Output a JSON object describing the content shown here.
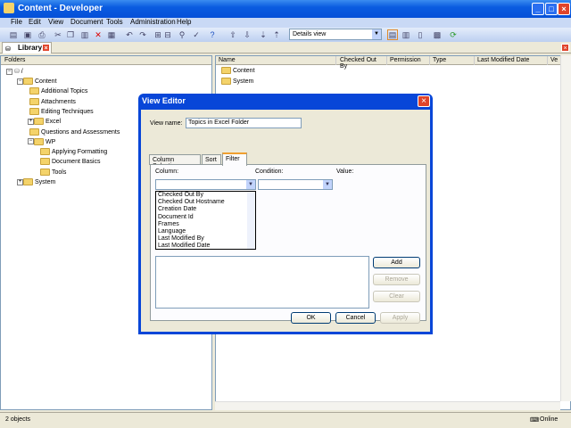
{
  "window": {
    "title": "Content - Developer"
  },
  "menu": [
    "File",
    "Edit",
    "View",
    "Document",
    "Tools",
    "Administration",
    "Help"
  ],
  "toolbar": {
    "view_select": "Details view"
  },
  "library_tab": "Library",
  "folders": {
    "header": "Folders",
    "root": "/",
    "items": [
      {
        "label": "Content",
        "level": 1
      },
      {
        "label": "Additional Topics",
        "level": 2
      },
      {
        "label": "Attachments",
        "level": 2
      },
      {
        "label": "Editing Techniques",
        "level": 2
      },
      {
        "label": "Excel",
        "level": 2
      },
      {
        "label": "Questions and Assessments",
        "level": 2
      },
      {
        "label": "WP",
        "level": 2
      },
      {
        "label": "Applying Formatting",
        "level": 3
      },
      {
        "label": "Document Basics",
        "level": 3
      },
      {
        "label": "Tools",
        "level": 3
      },
      {
        "label": "System",
        "level": 1
      }
    ]
  },
  "list": {
    "columns": [
      "Name",
      "Checked Out By",
      "Permission",
      "Type",
      "Last Modified Date",
      "Ve"
    ],
    "rows": [
      "Content",
      "System"
    ]
  },
  "status": {
    "count": "2 objects",
    "online": "Online"
  },
  "dialog": {
    "title": "View Editor",
    "view_name_label": "View name:",
    "view_name": "Topics in Excel Folder",
    "tabs": [
      "Column Selection",
      "Sort",
      "Filter"
    ],
    "active_tab": "Filter",
    "column_label": "Column:",
    "condition_label": "Condition:",
    "value_label": "Value:",
    "column_options": [
      "Checked Out By",
      "Checked Out Hostname",
      "Creation Date",
      "Document Id",
      "Frames",
      "Language",
      "Last Modified By",
      "Last Modified Date"
    ],
    "add": "Add",
    "remove": "Remove",
    "clear": "Clear",
    "ok": "OK",
    "cancel": "Cancel",
    "apply": "Apply"
  }
}
